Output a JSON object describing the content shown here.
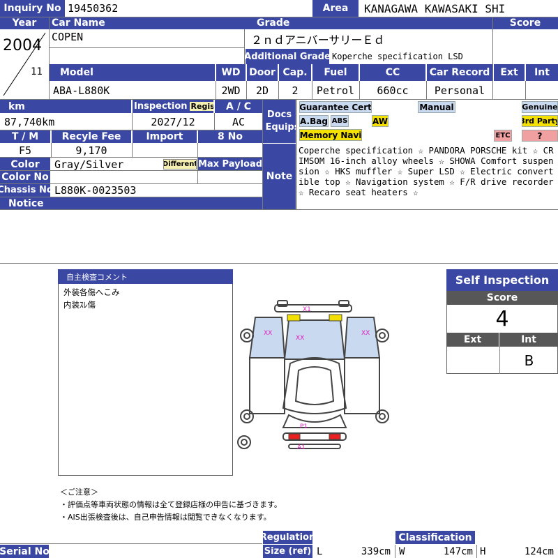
{
  "labels": {
    "inquiry_no": "Inquiry No",
    "area": "Area",
    "year": "Year",
    "car_name": "Car Name",
    "grade": "Grade",
    "score": "Score",
    "additional_grade": "Additional Grade",
    "model": "Model",
    "wd": "WD",
    "door": "Door",
    "cap": "Cap.",
    "fuel": "Fuel",
    "cc": "CC",
    "car_record": "Car Record",
    "ext": "Ext",
    "int": "Int",
    "km": "km",
    "inspection": "Inspection",
    "regist": "Regist",
    "ac": "A / C",
    "docs_equips": "Docs Equips",
    "tm": "T / M",
    "recycle_fee": "Recyle Fee",
    "import": "Import",
    "eight_no": "8 No",
    "color": "Color",
    "different": "Different",
    "max_payload": "Max Payload",
    "color_no": "Color No",
    "note": "Note",
    "chassis_no": "Chassis No",
    "notice": "Notice",
    "serial_no": "Serial No",
    "regulation": "Regulation",
    "size_ref": "Size (ref)",
    "classification": "Classification",
    "L": "L",
    "W": "W",
    "H": "H"
  },
  "vehicle": {
    "inquiry_no": "19450362",
    "area": "KANAGAWA KAWASAKI SHI",
    "year": "2004",
    "month": "11",
    "car_name": "COPEN",
    "grade": "２ｎｄアニバーサリーＥｄ",
    "additional_grade": "Koperche specification LSD",
    "model": "ABA-L880K",
    "wd": "2WD",
    "door": "2D",
    "cap": "2",
    "fuel": "Petrol",
    "cc": "660cc",
    "car_record": "Personal",
    "ext": "",
    "int": "",
    "score": "",
    "km": "87,740km",
    "inspection": "2027/12",
    "ac": "AC",
    "tm": "F5",
    "recycle_fee": "9,170",
    "import": "",
    "eight_no": "",
    "color": "Gray/Silver",
    "max_payload": "",
    "color_no": "",
    "chassis_no": "L880K-0023503",
    "notice": "",
    "note": "Coperche specification ☆ PANDORA PORSCHE kit ☆ CRIMSOM 16-inch alloy wheels ☆ SHOWA Comfort suspension ☆ HKS muffler ☆ Super LSD ☆ Electric convertible top ☆ Navigation system ☆ F/R drive recorder ☆ Recaro seat heaters ☆",
    "serial_no": ""
  },
  "equips": {
    "guarantee_cert": "Guarantee Cert",
    "manual": "Manual",
    "genuine": "Genuine",
    "abag": "A.Bag",
    "abs": "ABS",
    "aw": "AW",
    "third_party": "3rd Party",
    "memory_navi": "Memory Navi",
    "etc": "ETC",
    "question": "?"
  },
  "comment": {
    "title": "自主検査コメント",
    "lines": [
      "外装各傷へこみ",
      "内装ｽﾚ傷"
    ]
  },
  "diagram_marks": {
    "x1": "X1",
    "xx_left": "XX",
    "xx_center": "XX",
    "xx_right": "XX",
    "p1": "P1",
    "a1": "A1"
  },
  "self_inspection": {
    "title": "Self Inspection",
    "score_label": "Score",
    "score": "4",
    "ext_label": "Ext",
    "int_label": "Int",
    "ext": "",
    "int": "B"
  },
  "caution": {
    "title": "＜ご注意＞",
    "lines": [
      "・評価点等車両状態の情報は全て登録店様の申告に基づきます。",
      "・AIS出張検査後は、自己申告情報は閲覧できなくなります。"
    ]
  },
  "size": {
    "L": "339cm",
    "W": "147cm",
    "H": "124cm"
  },
  "colors": {
    "label_bg": "#3a48a4",
    "grid": "#7a7a7a",
    "panel_fill": "#c9d9ef",
    "mark_magenta": "#e020c0"
  }
}
